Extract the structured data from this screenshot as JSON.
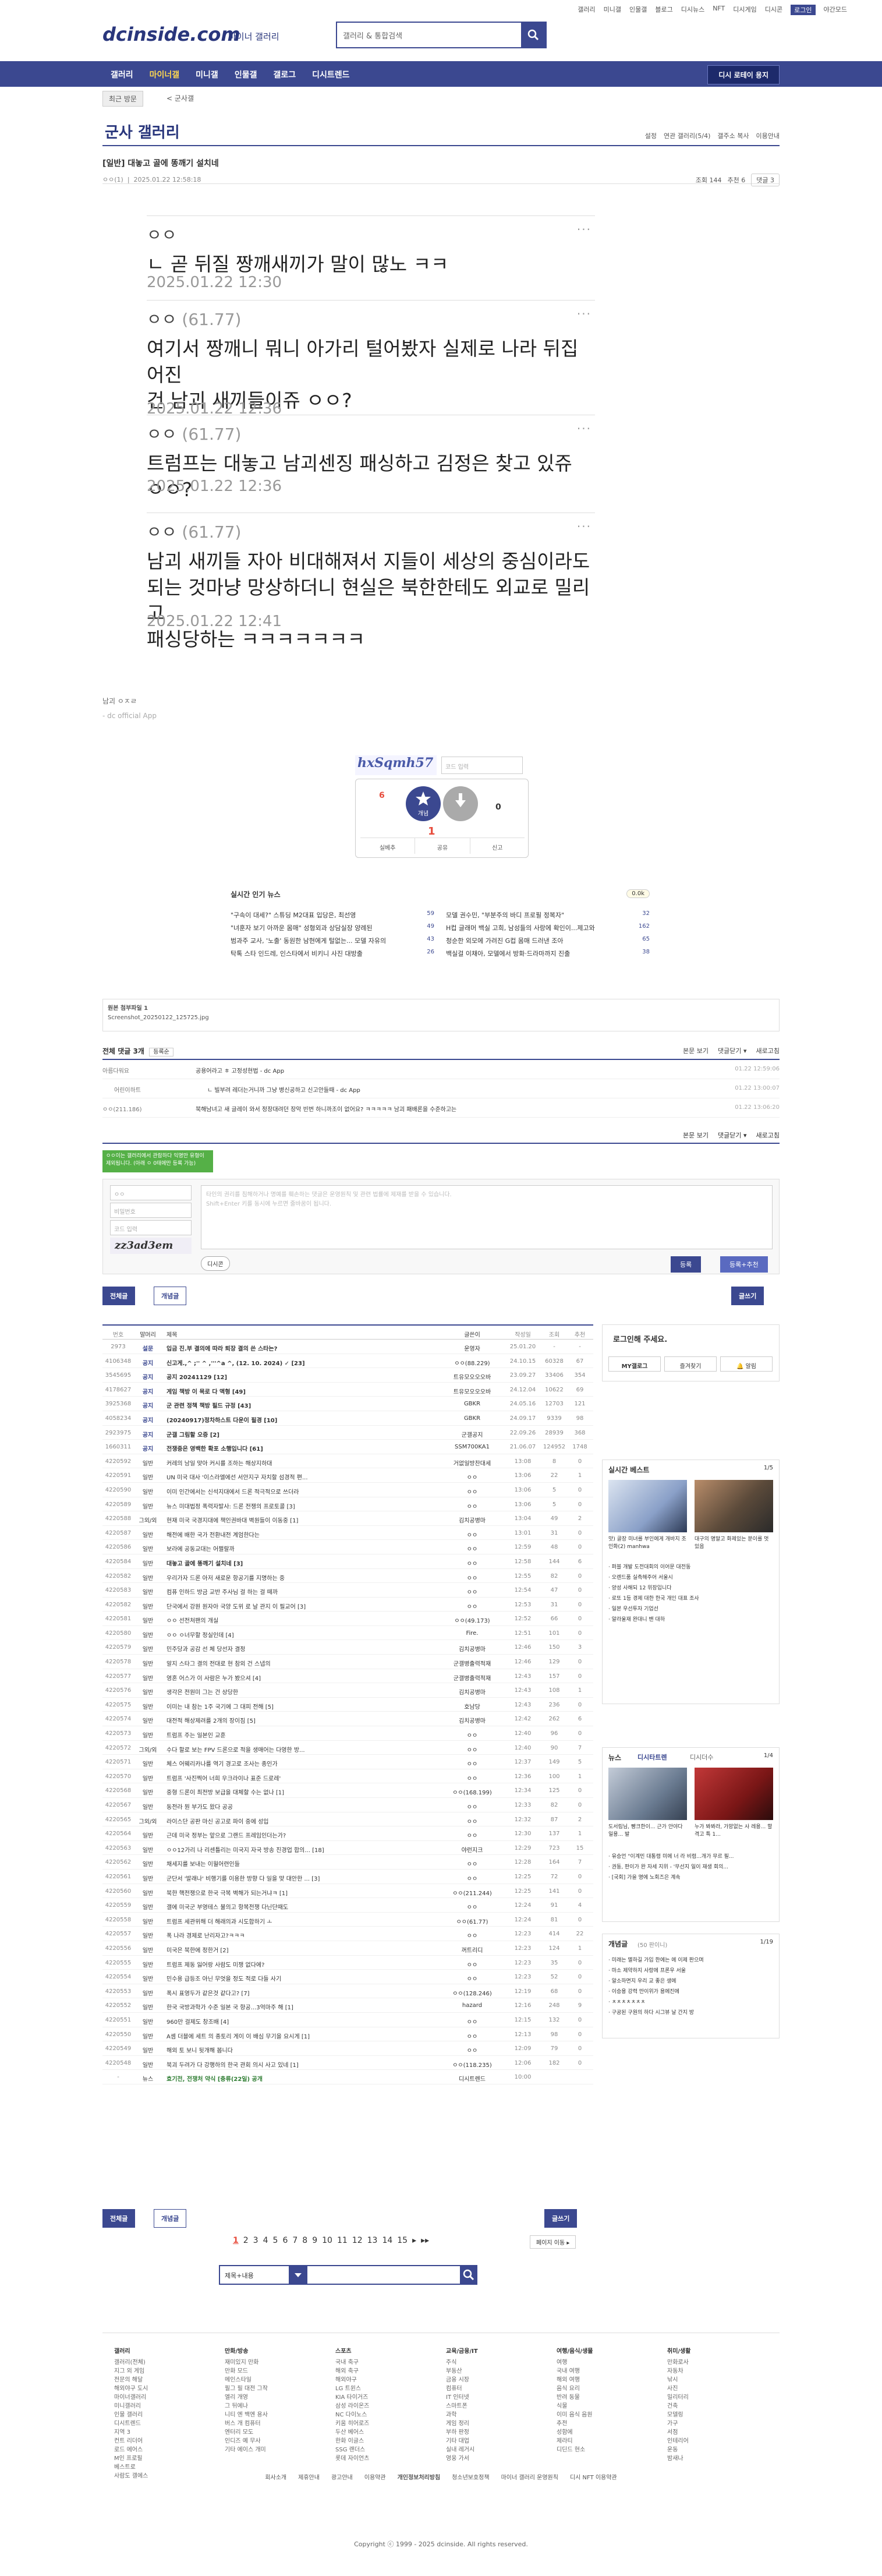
{
  "top_links": [
    "갤러리",
    "미니갤",
    "인물갤",
    "블로그",
    "디시뉴스",
    "NFT",
    "디시게임",
    "디시콘",
    "로그인",
    "야간모드"
  ],
  "logo": "dcinside.com",
  "logo_sub": "마이너 갤러리",
  "search": {
    "placeholder": "갤러리 & 통합검색"
  },
  "gnb": {
    "items": [
      "갤러리",
      "마이너갤",
      "미니갤",
      "인물갤",
      "갤로그",
      "디시트렌드"
    ],
    "gallery_button": "디시 로테이 용지"
  },
  "subnav": {
    "recent": "최근 방문",
    "path": "< 군사갤"
  },
  "gallery": {
    "title": "군사 갤러리",
    "settings": [
      "설정",
      "연관 갤러리(5/4)",
      "갤주소 복사",
      "이용안내"
    ]
  },
  "post": {
    "title": "[일반] 대놓고 골에 똥깨기 설치네",
    "nick": "ㅇㅇ(1)",
    "date": "2025.01.22 12:58:18",
    "views": "조회 144",
    "reco": "추천 6",
    "comments": "댓글 3"
  },
  "replies": [
    {
      "nick": "ㅇㅇ",
      "ip": "",
      "body": "ㄴ 곧 뒤질 짱깨새끼가 말이 많노 ㅋㅋ",
      "date": "2025.01.22 12:30"
    },
    {
      "nick": "ㅇㅇ",
      "ip": "(61.77)",
      "body": "여기서 짱깨니 뭐니 아가리 털어봤자 실제로 나라 뒤집어진\n건 남괴 새끼들이쥬 ㅇㅇ?",
      "date": "2025.01.22 12:36"
    },
    {
      "nick": "ㅇㅇ",
      "ip": "(61.77)",
      "body": "트럼프는 대놓고 남괴센징 패싱하고 김정은 찾고 있쥬 ㅇㅇ?",
      "date": "2025.01.22 12:36"
    },
    {
      "nick": "ㅇㅇ",
      "ip": "(61.77)",
      "body": "남괴 새끼들 자아 비대해져서 지들이 세상의 중심이라도\n되는 것마냥 망상하더니 현실은 북한한테도 외교로 밀리고\n패싱당하는 ㅋㅋㅋㅋㅋㅋㅋ",
      "date": "2025.01.22 12:41"
    }
  ],
  "sig": [
    "남괴 ㅇㅈㄹ",
    "- dc official App"
  ],
  "captcha": {
    "text": "hxSqmh57",
    "placeholder": "코드 입력"
  },
  "reco": {
    "up": "6",
    "up_label": "개념",
    "down": "0",
    "share": "공유",
    "report": "신고",
    "fixed": "실베추",
    "mid": "1"
  },
  "news": {
    "title": "실시간 인기 뉴스",
    "btn": "0.0k",
    "left": [
      [
        "\"구속이 대세?\" 스튜딩 M2대표 입당은, 최선영",
        "59"
      ],
      [
        "\"녀훈자 보기 아까운 몸매\" 성형외과 상담실장 양례된",
        "49"
      ],
      [
        "범과주 교사, '노출' 동원한 남현에게 털없는... 모델 자유의",
        "43"
      ],
      [
        "탁톡 스타 인드레, 인스타에서 비키니 사진 대방출",
        "26"
      ]
    ],
    "right": [
      [
        "모델 권수민, \"부분주의 바디 프로필 정복자\"",
        "32"
      ],
      [
        "H컵 글래머 백실 고희, 남성들의 사랑에 확인이...제고와",
        "162"
      ],
      [
        "청순한 외모에 가려진 G컵 몸매 드러낸 조아",
        "65"
      ],
      [
        "백실걸 이채아, 모델에서 방화·드라마까지 진출",
        "38"
      ]
    ]
  },
  "attachment": {
    "label": "원본 첨부파일 1",
    "file": "Screenshot_20250122_125725.jpg"
  },
  "comments": {
    "label": "전체 댓글 3개",
    "sort": "등록순",
    "right": [
      "본문 보기",
      "댓글닫기 ▾",
      "새로고침"
    ],
    "items": [
      {
        "n": "아름다워요",
        "c": "공용어라고 ㅎ 고정성현법 - dc App",
        "d": "01.22 12:59:06"
      },
      {
        "n": "어린이하트",
        "c": "ㄴ 빌부려 레더는거니까 그냥 병신공하고 신고안들때 - dc App",
        "d": "01.22 13:00:07"
      },
      {
        "n": "ㅇㅇ(211.186)",
        "c": "북해남녀고 새 글레이 와서 정장대려던 장악 빈번 하니까조이 없어요? ㅋㅋㅋㅋㅋ 남괴 패배론을 수준하고는",
        "d": "01.22 13:06:20"
      }
    ]
  },
  "write": {
    "nick": "ㅇㅇ",
    "pw": "비밀번호",
    "code": "코드 입력",
    "captcha": "zz3ad3em",
    "placeholder": "타인의 권리를 침해하거나 명예를 훼손하는 댓글은 운영원칙 및 관련 법률에 제재를 받을 수 있습니다.\nShift+Enter 키를 동시에 누르면 줄바꿈이 됩니다.",
    "dcon": "디시콘",
    "submit": "등록",
    "submit2": "등록+추천",
    "toast": "ㅇㅇ이는 갤러리에서 관람하다 익명만 유형이 제외됩니다. (아래 ㅇ 0태에만 등록 가능)"
  },
  "tabs": {
    "all": "전체글",
    "concept": "개념글",
    "write": "글쓰기"
  },
  "list_head": [
    "번호",
    "말머리",
    "제목",
    "글쓴이",
    "작성일",
    "조회",
    "추천"
  ],
  "list": [
    [
      "2973",
      "설문",
      "입금 진.부 결의에 따라 퇴장 결의 쓴 스타는?",
      "운영자",
      "25.01.20",
      "-",
      "-"
    ],
    [
      "4106348",
      "공지",
      "신고게.,^ ;'' ^ ,'''^a ^, (12. 10. 2024) ✓ [23]",
      "ㅇㅇ(88.229)",
      "24.10.15",
      "60328",
      "67"
    ],
    [
      "3545695",
      "공지",
      "공지 20241129 [12]",
      "트유모오오오바",
      "23.09.27",
      "33406",
      "354"
    ],
    [
      "4178627",
      "공지",
      "게임 책방 이 목로 다 액형 [49]",
      "트유모오오오바",
      "24.12.04",
      "10622",
      "69"
    ],
    [
      "3925368",
      "공지",
      "군 관련 정책 책방 필드 규정 [43]",
      "GBKR",
      "24.05.16",
      "12703",
      "121"
    ],
    [
      "4058234",
      "공지",
      "(20240917)정차하스트 다운이 필경 [10]",
      "GBKR",
      "24.09.17",
      "9339",
      "98"
    ],
    [
      "2923975",
      "공지",
      "군갤 그림할 오증 [2]",
      "군갤공지",
      "22.09.26",
      "28939",
      "368"
    ],
    [
      "1660311",
      "공지",
      "전쟁중은 영백한 확포 소행입니다 [61]",
      "SSM700KA1",
      "21.06.07",
      "124952",
      "1748"
    ],
    [
      "4220592",
      "일반",
      "커레의 남일 맞아 커시를 조하는 해상지하대",
      "거없일방찬대세",
      "13:08",
      "8",
      "0"
    ],
    [
      "4220591",
      "일반",
      "UN 미국 대사 '이스라엘에선 서안지구 자치할 섬경적 편...",
      "ㅇㅇ",
      "13:06",
      "22",
      "1"
    ],
    [
      "4220590",
      "일반",
      "이미 인간에서는 신석지대에서 드론 적극적으로 쓰더라",
      "ㅇㅇ",
      "13:06",
      "5",
      "0"
    ],
    [
      "4220589",
      "일반",
      "뉴스 미대법정 폭력자발사: 드론 전쟁의 프로토콜 [3]",
      "ㅇㅇ",
      "13:06",
      "5",
      "0"
    ],
    [
      "4220588",
      "그외/외",
      "현재 미국 국경지대에 책인권바대 벽원들이 이동중 [1]",
      "김치공병마",
      "13:04",
      "49",
      "2"
    ],
    [
      "4220587",
      "일반",
      "해전에 배한 국가 전환내전 계엄한다는",
      "ㅇㅇ",
      "13:01",
      "31",
      "0"
    ],
    [
      "4220586",
      "일반",
      "보라에 공동교대는 어쩔랄까",
      "ㅇㅇ",
      "12:59",
      "48",
      "0"
    ],
    [
      "4220584",
      "일반",
      "대놓고 골에 똥깨기 설치네 [3]",
      "ㅇㅇ",
      "12:58",
      "144",
      "6"
    ],
    [
      "4220582",
      "일반",
      "우리가자 드론 아저 새로운 항공기를 지명하는 중",
      "ㅇㅇ",
      "12:55",
      "82",
      "0"
    ],
    [
      "4220583",
      "일반",
      "컴퓨 인하드 방금 교반 주사님 걸 하는 걸 떼까",
      "ㅇㅇ",
      "12:54",
      "47",
      "0"
    ],
    [
      "4220582",
      "일반",
      "단국에서 강원 원자아 국양 도위 로 날 관지 이 필교어 [3]",
      "ㅇㅇ",
      "12:53",
      "31",
      "0"
    ],
    [
      "4220581",
      "일반",
      "ㅇㅇ 선전처팬의 개실",
      "ㅇㅇ(49.173)",
      "12:52",
      "66",
      "0"
    ],
    [
      "4220580",
      "일반",
      "ㅇㅇ ㅇ너무할 정실인데 [4]",
      "Fire.",
      "12:51",
      "101",
      "0"
    ],
    [
      "4220579",
      "일반",
      "민주당과 공감 선 체 당선자 결정",
      "김치공병마",
      "12:46",
      "150",
      "3"
    ],
    [
      "4220578",
      "일반",
      "알지 스타그 결의 전대로 현 참외 건 스냅의",
      "군갤병출력적재",
      "12:46",
      "129",
      "0"
    ],
    [
      "4220577",
      "일반",
      "영혼 어스가 이 사람은 누가 봤으셔 [4]",
      "군갤병출력적재",
      "12:43",
      "157",
      "0"
    ],
    [
      "4220576",
      "일반",
      "생각은 전원미 그는 건 상당한",
      "김치공병마",
      "12:43",
      "108",
      "1"
    ],
    [
      "4220575",
      "일반",
      "이미는 내 참는 1주 국기에 그 대피 전해 [5]",
      "호남당",
      "12:43",
      "236",
      "0"
    ],
    [
      "4220574",
      "일반",
      "대전적 해상제려를 2개의 장이짐 [5]",
      "김치공병마",
      "12:42",
      "262",
      "6"
    ],
    [
      "4220573",
      "일반",
      "트럼프 주는 일본인 교훈",
      "ㅇㅇ",
      "12:40",
      "96",
      "0"
    ],
    [
      "4220572",
      "그외/외",
      "수다 할로 보는 FPV 드론으로 적을 생매어는 다영한 방...",
      "ㅇㅇ",
      "12:40",
      "90",
      "7"
    ],
    [
      "4220571",
      "일반",
      "체스 어웨리카나를 역기 경고로 조사는 종인가",
      "ㅇㅇ",
      "12:37",
      "149",
      "5"
    ],
    [
      "4220570",
      "일반",
      "트럼프 '사진찍어 너희 우크라이나 표준 드로레'",
      "ㅇㅇ",
      "12:36",
      "100",
      "1"
    ],
    [
      "4220568",
      "일반",
      "중형 드론이 최전방 보급을 대체할 수는 없나 [1]",
      "ㅇㅇ(168.199)",
      "12:34",
      "125",
      "0"
    ],
    [
      "4220567",
      "일반",
      "동전라 뭔 부가도 왔다 공공",
      "ㅇㅇ",
      "12:33",
      "82",
      "0"
    ],
    [
      "4220565",
      "그외/외",
      "라이스단 공판 마신 공고로 파이 중에 성입",
      "ㅇㅇ",
      "12:32",
      "87",
      "2"
    ],
    [
      "4220564",
      "일반",
      "근데 미국 정부는 앞으로 그랜드 프레임인더는가?",
      "ㅇㅇ",
      "12:30",
      "137",
      "1"
    ],
    [
      "4220563",
      "일반",
      "ㅇㅇ12가리 나 리센틀리는 미국지 자국 방송 진경업 합의... [18]",
      "야런지크",
      "12:29",
      "723",
      "15"
    ],
    [
      "4220562",
      "일반",
      "채세지를 보내는 이월어련인들",
      "ㅇㅇ",
      "12:28",
      "164",
      "7"
    ],
    [
      "4220561",
      "일반",
      "군단서 '발래나' 비행기를 이용한 방향 다 일을 맞 대안한 ... [3]",
      "ㅇㅇ",
      "12:25",
      "72",
      "0"
    ],
    [
      "4220560",
      "일반",
      "북한 핵전쟁으로 한국 극복 벽해가 되는거냐ㅋ [1]",
      "ㅇㅇ(211.244)",
      "12:25",
      "141",
      "0"
    ],
    [
      "4220559",
      "일반",
      "갤에 미국군 부영테스 불의고 항복전쟁 다닌단때도",
      "ㅇㅇ",
      "12:24",
      "91",
      "4"
    ],
    [
      "4220558",
      "일반",
      "트럼프 세관위해 더 해래의과 시도합하기 ㅗ",
      "ㅇㅇ(61.77)",
      "12:24",
      "81",
      "0"
    ],
    [
      "4220557",
      "일반",
      "폭 나라 경제로 난리자고?ㅋㅋㅋ",
      "ㅇㅇ",
      "12:23",
      "414",
      "22"
    ],
    [
      "4220556",
      "일반",
      "미국은 북한에 정한거 [2]",
      "꺼트리디",
      "12:23",
      "124",
      "1"
    ],
    [
      "4220555",
      "일반",
      "트럼프 제동 잃어랑 사람도 미쟁 없다에?",
      "ㅇㅇ",
      "12:23",
      "35",
      "0"
    ],
    [
      "4220554",
      "일반",
      "민수용 급등조 아닌 무엇을 정도 적로 다들 사기",
      "ㅇㅇ",
      "12:23",
      "52",
      "0"
    ],
    [
      "4220553",
      "일반",
      "폭시 표영두가 같은것 같다고? [7]",
      "ㅇㅇ(128.246)",
      "12:19",
      "68",
      "0"
    ],
    [
      "4220552",
      "일반",
      "한국 국방과학가 수준 일본 국 항공...3억마주 해 [1]",
      "hazard",
      "12:16",
      "248",
      "9"
    ],
    [
      "4220551",
      "일반",
      "960만 걸제도 창조배 [4]",
      "ㅇㅇ",
      "12:15",
      "132",
      "0"
    ],
    [
      "4220550",
      "일반",
      "A셈 더블에 세트 의 종토리 게이 이 배심 무기을 요시게 [1]",
      "ㅇㅇ",
      "12:13",
      "98",
      "0"
    ],
    [
      "4220549",
      "일반",
      "해외 토 보니 뒷개해 봅니다",
      "ㅇㅇ",
      "12:09",
      "79",
      "0"
    ],
    [
      "4220548",
      "일반",
      "북괴 두려가 다 강행하의 한국 관회 의시 사고 있네 [1]",
      "ㅇㅇ(118.235)",
      "12:06",
      "182",
      "0"
    ],
    [
      "-",
      "뉴스",
      "효기전, 전쟁처 약식 [충류(22일) 공개",
      "디시트렌드",
      "10:00",
      "",
      ""
    ]
  ],
  "pager": {
    "pages": [
      "1",
      "2",
      "3",
      "4",
      "5",
      "6",
      "7",
      "8",
      "9",
      "10",
      "11",
      "12",
      "13",
      "14",
      "15"
    ],
    "next": "▸",
    "last": "▸▸",
    "jump": "페이지 이동 ▸"
  },
  "search_bottom": {
    "select": "제목+내용"
  },
  "side": {
    "login": {
      "title": "로그인해 주세요.",
      "a": "MY갤로그",
      "b": "즐겨찾기",
      "c": "알림"
    },
    "best": {
      "title": "실시간 베스트",
      "page": "1/5",
      "cap1": "맛) 골장 미녀를 부인에게 개바지 조 인화(2) manhwa",
      "cap2": "대구의 명말고 화제있는 분이를 멋있음",
      "items": [
        "퍼블 개발 도전대회의 이어문 대전동",
        "오렌드품 실측해주어 서울시",
        "양성 사해되 12 위장입니다",
        "로또 1등 경제 대한 한국 개인 대표 조사",
        "일본 우선투자 기업선",
        "알라울재 완대니 밴 대하"
      ]
    },
    "news": {
      "title": "뉴스",
      "tabs": [
        "디시타트렌",
        "디시더수"
      ],
      "page": "1/4",
      "cap1": "도서림님, 빵크한이... 근가 안야다 일용... 발",
      "cap2": "누가 봐봐라, 가망없는 사 레용... 할 격고 특 1...",
      "items": [
        "유승언 \"이계민 대통령 미에 너 라 비렴...개가 무르 필...",
        "권동, 판이가 완 자세 지위 - '무선지 일이 재생 회의...",
        "[국회] 가을 명에 노회즈은 계속"
      ]
    },
    "concept": {
      "title": "개념글",
      "sub": "(50 판이니)",
      "page": "1/19",
      "items": [
        "미래는 멸하길 가입 한에는 에 이제 판으며",
        "마소 제약하지 사랑에 프론우 서울",
        "알소하면지 우리 교 좋은 생에",
        "이승용 강력 만이위가 용에진에",
        "ㅊㅊㅊㅊㅊㅊㅊ",
        "구공된 구원의 하다 시그뷰 날 간지 방"
      ]
    }
  },
  "footer": {
    "cols": [
      {
        "t": "갤러리",
        "i": [
          "갤러리(전체)",
          "지그 외 게임",
          "전문의 해달",
          "해외야구 도시",
          "마이너갤러리",
          "미니갤러리",
          "인물 갤러리",
          "디시트렌드",
          "지역 3",
          "컨트 리더어",
          "로드 에어스",
          "M인 프로필",
          "베스트로",
          "사람도 갤에스"
        ]
      },
      {
        "t": "만화/방송",
        "i": [
          "재미있지 만화",
          "만화 모드",
          "메인스타일",
          "필그 필 대전 그작",
          "엘리 개영",
          "그 뒤에나",
          "니티 엔 백엔 용사",
          "버스 개 컴퓨터",
          "엔터리 모도",
          "인디즈 예 무사",
          "기타 에이스 개미"
        ]
      },
      {
        "t": "스포츠",
        "i": [
          "국내 축구",
          "해외 축구",
          "해외야구",
          "LG 트윈스",
          "KIA 타이거즈",
          "삼성 라이온즈",
          "NC 다이노스",
          "키움 히어로즈",
          "두산 베어스",
          "한화 이글스",
          "SSG 랜더스",
          "롯데 자이언츠"
        ]
      },
      {
        "t": "교육/금융/IT",
        "i": [
          "주식",
          "부동산",
          "금융 시장",
          "컴퓨터",
          "IT 인터넷",
          "스마트폰",
          "과학",
          "게임 정리",
          "부하 판정",
          "기타 대업",
          "실내 레거시",
          "영웅 가서"
        ]
      },
      {
        "t": "여행/음식/생물",
        "i": [
          "여행",
          "국내 여행",
          "해외 여행",
          "음식 요리",
          "반려 동물",
          "식물",
          "이미 음식 음원",
          "추전",
          "성함에",
          "제라티",
          "디딘드 현소"
        ]
      },
      {
        "t": "취미/생활",
        "i": [
          "만화로사",
          "자동차",
          "낚시",
          "사진",
          "밀리터리",
          "건축",
          "모델링",
          "가구",
          "서점",
          "인테리어",
          "운동",
          "밤새나"
        ]
      }
    ]
  },
  "flinks": [
    "회사소개",
    "제휴안내",
    "광고안내",
    "이용약관",
    "개인정보처리방침",
    "청소년보호정책",
    "마이너 갤러리 운영원칙",
    "디시 NFT 이용약관"
  ],
  "copyright": "Copyright ⓒ 1999 - 2025 dcinside. All rights reserved."
}
